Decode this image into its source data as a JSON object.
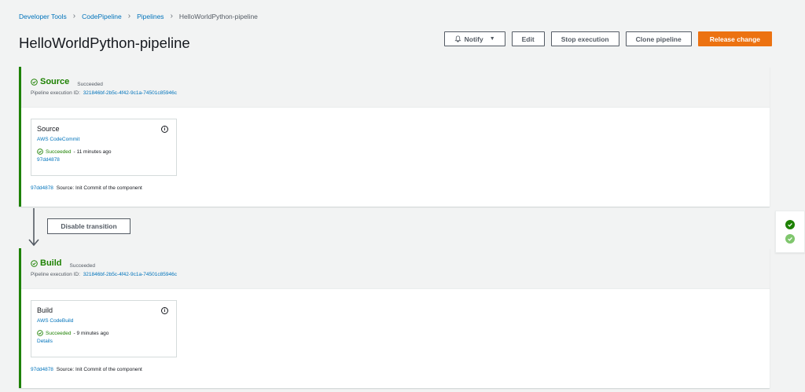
{
  "breadcrumb": {
    "items": [
      "Developer Tools",
      "CodePipeline",
      "Pipelines"
    ],
    "current": "HelloWorldPython-pipeline"
  },
  "page": {
    "title": "HelloWorldPython-pipeline"
  },
  "actions": {
    "notify": "Notify",
    "edit": "Edit",
    "stop": "Stop execution",
    "clone": "Clone pipeline",
    "release": "Release change"
  },
  "stages": [
    {
      "name": "Source",
      "status": "Succeeded",
      "exec_label": "Pipeline execution ID:",
      "exec_id": "321846bf-2b5c-4f42-9c1a-74501c85946c",
      "action": {
        "name": "Source",
        "provider": "AWS CodeCommit",
        "status": "Succeeded",
        "time": "- 11 minutes ago",
        "link": "97dd4878"
      },
      "commit": {
        "id": "97dd4878",
        "message": "Source: Init Commit of the component"
      }
    },
    {
      "name": "Build",
      "status": "Succeeded",
      "exec_label": "Pipeline execution ID:",
      "exec_id": "321846bf-2b5c-4f42-9c1a-74501c85946c",
      "action": {
        "name": "Build",
        "provider": "AWS CodeBuild",
        "status": "Succeeded",
        "time": "- 9 minutes ago",
        "link": "Details"
      },
      "commit": {
        "id": "97dd4878",
        "message": "Source: Init Commit of the component"
      }
    }
  ],
  "transition": {
    "label": "Disable transition"
  },
  "colors": {
    "success": "#1d8102",
    "link": "#0073bb",
    "primary": "#ec7211",
    "success_light": "#7fc66d"
  }
}
